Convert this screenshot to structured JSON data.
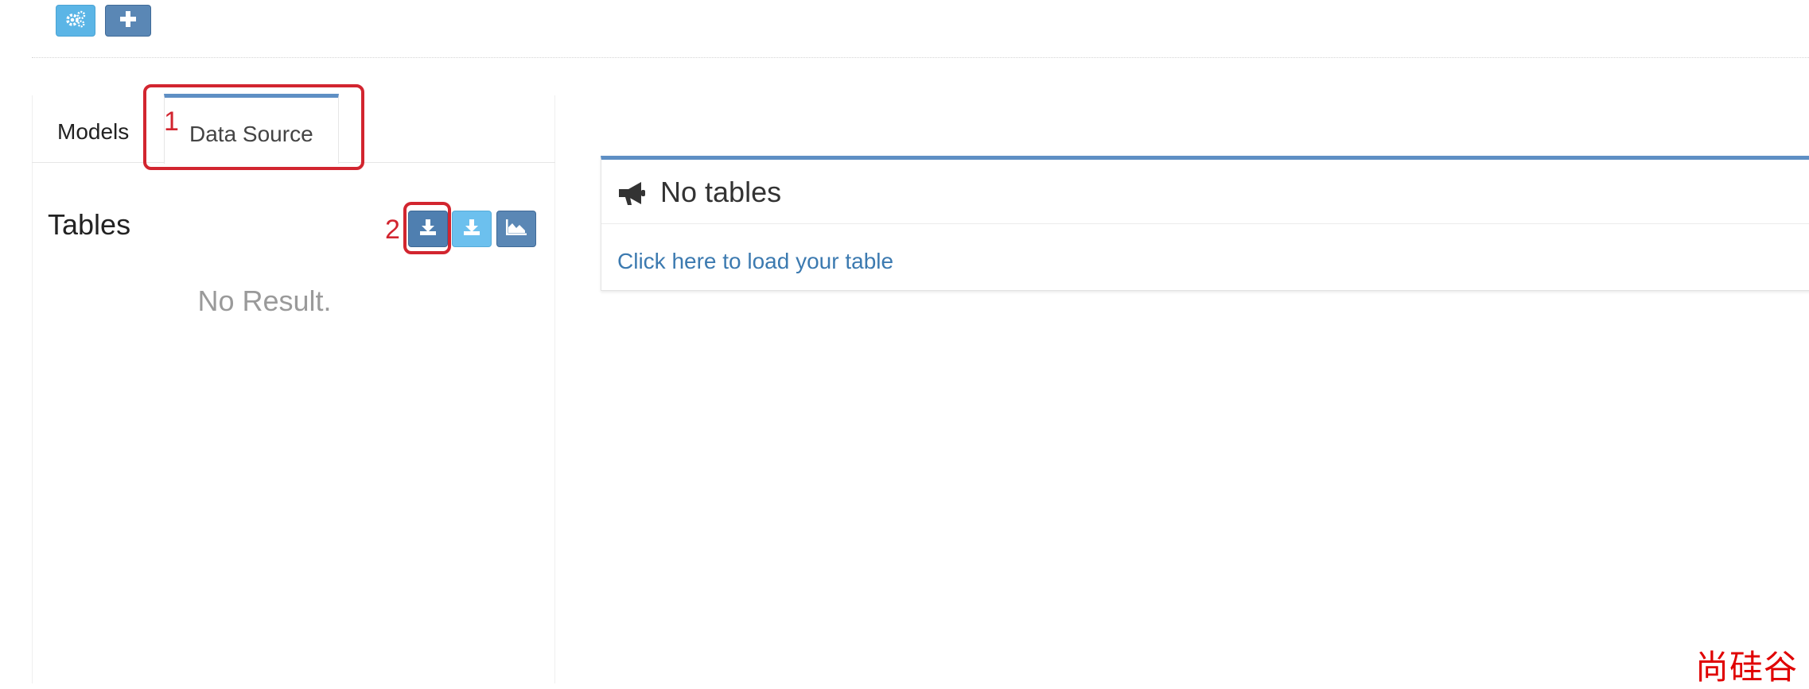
{
  "toolbar": {
    "settings_icon": "gears-icon",
    "add_icon": "plus-icon"
  },
  "tabs": [
    {
      "label": "Models",
      "active": false
    },
    {
      "label": "Data Source",
      "active": true
    }
  ],
  "tables_panel": {
    "title": "Tables",
    "empty_text": "No Result.",
    "actions": [
      {
        "icon": "download-icon",
        "name": "load-hive-table"
      },
      {
        "icon": "download-icon",
        "name": "load-table-light"
      },
      {
        "icon": "area-chart-icon",
        "name": "streaming-table"
      }
    ]
  },
  "annotations": {
    "step1": "1",
    "step2": "2",
    "color": "#d2252f"
  },
  "main_card": {
    "title": "No tables",
    "icon": "bullhorn-icon",
    "link_text": "Click here to load your table"
  },
  "watermark": "尚硅谷",
  "colors": {
    "primary": "#5a87b5",
    "info": "#5bb5e6",
    "accent_border": "#5e8fc4",
    "link": "#3c7ab0"
  }
}
